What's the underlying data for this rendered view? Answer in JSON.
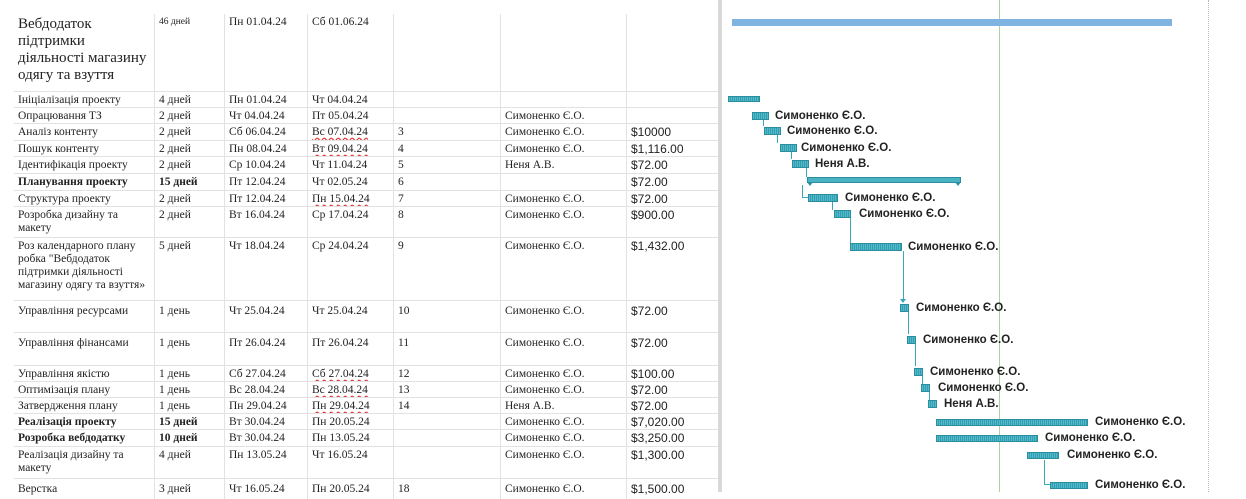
{
  "tasks": [
    {
      "name": "Вебдодаток підтримки діяльності магазину одягу та взуття",
      "duration": "46 дней",
      "start": "Пн 01.04.24",
      "end": "Сб 01.06.24",
      "pred": "",
      "resource": "",
      "cost": ""
    },
    {
      "name": "Ініціалізація проекту",
      "duration": "4 дней",
      "start": "Пн 01.04.24",
      "end": "Чт 04.04.24",
      "pred": "",
      "resource": "",
      "cost": ""
    },
    {
      "name": "Опрацювання ТЗ",
      "duration": "2 дней",
      "start": "Чт 04.04.24",
      "end": "Пт 05.04.24",
      "pred": "",
      "resource": "Симоненко Є.О.",
      "cost": ""
    },
    {
      "name": "Аналіз контенту",
      "duration": "2 дней",
      "start": "Сб 06.04.24",
      "end": "Вс 07.04.24",
      "pred": "3",
      "resource": "Симоненко Є.О.",
      "cost": "$10000"
    },
    {
      "name": "Пошук контенту",
      "duration": "2 дней",
      "start": "Пн 08.04.24",
      "end": "Вт 09.04.24",
      "pred": "4",
      "resource": "Симоненко Є.О.",
      "cost": "$1,116.00"
    },
    {
      "name": "Ідентифікація проекту",
      "duration": "2 дней",
      "start": "Ср 10.04.24",
      "end": "Чт 11.04.24",
      "pred": "5",
      "resource": "Неня А.В.",
      "cost": "$72.00"
    },
    {
      "name": "Планування проекту",
      "duration": "15 дней",
      "start": "Пт 12.04.24",
      "end": "Чт 02.05.24",
      "pred": "6",
      "resource": "",
      "cost": "$72.00"
    },
    {
      "name": "Структура проекту",
      "duration": "2 дней",
      "start": "Пт 12.04.24",
      "end": "Пн 15.04.24",
      "pred": "7",
      "resource": "Симоненко Є.О.",
      "cost": "$72.00"
    },
    {
      "name": "Розробка дизайну та макету",
      "duration": "2 дней",
      "start": "Вт 16.04.24",
      "end": "Ср 17.04.24",
      "pred": "8",
      "resource": "Симоненко Є.О.",
      "cost": "$900.00"
    },
    {
      "name": "Роз календарного плану робка \"Вебдодаток підтримки діяльності магазину одягу та взуття»",
      "duration": "5 дней",
      "start": "Чт 18.04.24",
      "end": "Ср 24.04.24",
      "pred": "9",
      "resource": "Симоненко Є.О.",
      "cost": "$1,432.00"
    },
    {
      "name": "Управління ресурсами",
      "duration": "1 день",
      "start": "Чт 25.04.24",
      "end": "Чт 25.04.24",
      "pred": "10",
      "resource": "Симоненко Є.О.",
      "cost": "$72.00"
    },
    {
      "name": "Управління фінансами",
      "duration": "1 день",
      "start": "Пт 26.04.24",
      "end": "Пт 26.04.24",
      "pred": "11",
      "resource": "Симоненко Є.О.",
      "cost": "$72.00"
    },
    {
      "name": "Управління якістю",
      "duration": "1 день",
      "start": "Сб 27.04.24",
      "end": "Сб 27.04.24",
      "pred": "12",
      "resource": "Симоненко Є.О.",
      "cost": "$100.00"
    },
    {
      "name": "Оптимізація плану",
      "duration": "1 день",
      "start": "Вс 28.04.24",
      "end": "Вс 28.04.24",
      "pred": "13",
      "resource": "Симоненко Є.О.",
      "cost": "$72.00"
    },
    {
      "name": "Затвердження плану",
      "duration": "1 день",
      "start": "Пн 29.04.24",
      "end": "Пн 29.04.24",
      "pred": "14",
      "resource": "Неня А.В.",
      "cost": "$72.00"
    },
    {
      "name": "Реалізація проекту",
      "duration": "15 дней",
      "start": "Вт 30.04.24",
      "end": "Пн 20.05.24",
      "pred": "",
      "resource": "Симоненко Є.О.",
      "cost": "$7,020.00"
    },
    {
      "name": "Розробка вебдодатку",
      "duration": "10 дней",
      "start": "Вт 30.04.24",
      "end": "Пн 13.05.24",
      "pred": "",
      "resource": "Симоненко Є.О.",
      "cost": "$3,250.00"
    },
    {
      "name": "Реалізація дизайну та макету",
      "duration": "4 дней",
      "start": "Пн 13.05.24",
      "end": "Чт 16.05.24",
      "pred": "",
      "resource": "Симоненко Є.О.",
      "cost": "$1,300.00"
    },
    {
      "name": "Верстка",
      "duration": "3 дней",
      "start": "Чт 16.05.24",
      "end": "Пн 20.05.24",
      "pred": "18",
      "resource": "Симоненко Є.О.",
      "cost": "$1,500.00"
    }
  ],
  "gantt_labels": [
    "Симоненко Є.О.",
    "Симоненко Є.О.",
    "Симоненко Є.О.",
    "Неня А.В.",
    "Симоненко Є.О.",
    "Симоненко Є.О.",
    "Симоненко Є.О.",
    "Симоненко Є.О.",
    "Симоненко Є.О.",
    "Симоненко Є.О.",
    "Симоненко Є.О.",
    "Неня А.В.",
    "Симоненко Є.О.",
    "Симоненко Є.О.",
    "Симоненко Є.О.",
    "Симоненко Є.О."
  ]
}
